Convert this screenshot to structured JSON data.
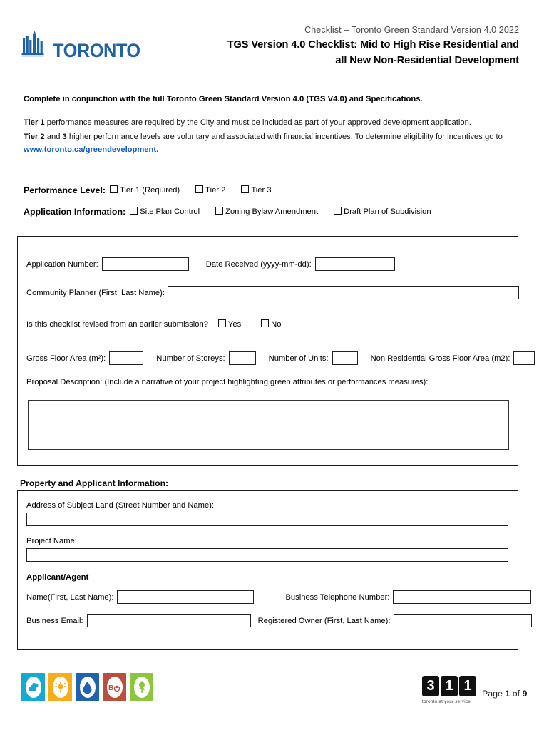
{
  "header": {
    "logo_word": "TORONTO",
    "logo_icon": "toronto-city-buildings-logo",
    "subtitle": "Checklist – Toronto Green Standard Version 4.0 2022",
    "title_line1": "TGS Version 4.0 Checklist: Mid to High Rise Residential and",
    "title_line2": "all New Non-Residential Development"
  },
  "intro": {
    "bold_line": "Complete in conjunction with the full Toronto Green Standard Version 4.0 (TGS V4.0) and Specifications.",
    "tier1_bold": "Tier 1",
    "tier1_rest": " performance measures are required by the City and must be included as part of your approved development application.",
    "tier2_bold": "Tier 2",
    "tier2_mid": " and ",
    "tier2_bold2": "3",
    "tier2_rest": " higher performance levels are voluntary and associated with financial incentives. To determine eligibility for incentives go to",
    "link_text": "www.toronto.ca/greendevelopment."
  },
  "performance_level": {
    "label": "Performance Level:",
    "options": [
      {
        "label": "Tier 1 (Required)",
        "checked": false
      },
      {
        "label": "Tier 2",
        "checked": false
      },
      {
        "label": "Tier 3",
        "checked": false
      }
    ]
  },
  "application_information": {
    "label": "Application Information:",
    "options": [
      {
        "label": "Site Plan Control",
        "checked": false
      },
      {
        "label": "Zoning Bylaw Amendment",
        "checked": false
      },
      {
        "label": "Draft Plan of Subdivision",
        "checked": false
      }
    ]
  },
  "form": {
    "application_number_label": "Application Number:",
    "application_number_value": "",
    "date_received_label": "Date Received (yyyy-mm-dd):",
    "date_received_value": "",
    "community_planner_label": "Community Planner (First, Last Name):",
    "community_planner_value": "",
    "revised_question": "Is this checklist revised from an earlier submission?",
    "revised_yes": "Yes",
    "revised_no": "No",
    "gross_floor_area_label": "Gross Floor Area (m²):",
    "gross_floor_area_value": "",
    "number_of_storeys_label": "Number of Storeys:",
    "number_of_storeys_value": "",
    "number_of_units_label": "Number of Units:",
    "number_of_units_value": "",
    "non_residential_gfa_label": "Non Residential Gross Floor Area (m2):",
    "non_residential_gfa_value": "",
    "proposal_description_label": "Proposal Description: (Include a narrative of your project highlighting green attributes or performances measures):",
    "proposal_description_value": ""
  },
  "property": {
    "section_title": "Property and Applicant Information:",
    "address_label": "Address of Subject Land (Street Number and Name):",
    "address_value": "",
    "project_name_label": "Project Name:",
    "project_name_value": "",
    "applicant_agent_heading": "Applicant/Agent",
    "name_label": "Name(First, Last Name):",
    "name_value": "",
    "business_phone_label": "Business Telephone Number:",
    "business_phone_value": "",
    "business_email_label": "Business Email:",
    "business_email_value": "",
    "registered_owner_label": "Registered Owner (First, Last Name):",
    "registered_owner_value": ""
  },
  "footer": {
    "icons": [
      {
        "name": "air-quality-icon",
        "color": "#17AACF",
        "glyph": "city-cloud"
      },
      {
        "name": "energy-efficiency-icon",
        "color": "#F6AD19",
        "glyph": "sun"
      },
      {
        "name": "water-quality-icon",
        "color": "#1F62AD",
        "glyph": "droplet"
      },
      {
        "name": "ecology-co2-icon",
        "color": "#B9503F",
        "glyph": "co2"
      },
      {
        "name": "solid-waste-icon",
        "color": "#8CC63E",
        "glyph": "tree"
      }
    ],
    "logo311_digits": [
      "3",
      "1",
      "1"
    ],
    "logo311_tagline": "toronto at your service",
    "page_prefix": "Page ",
    "page_current": "1",
    "page_of": " of ",
    "page_total": "9"
  }
}
